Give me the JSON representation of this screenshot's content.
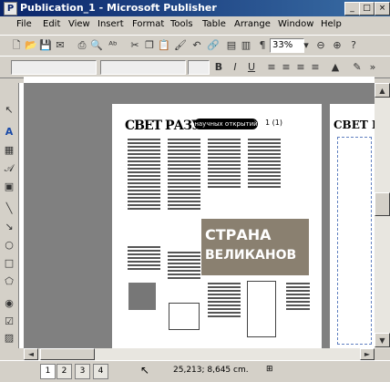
{
  "window": {
    "title": "Publication_1 - Microsoft Publisher",
    "app_icon": "P"
  },
  "menu": [
    "File",
    "Edit",
    "View",
    "Insert",
    "Format",
    "Tools",
    "Table",
    "Arrange",
    "Window",
    "Help"
  ],
  "toolbar": {
    "zoom": "33%"
  },
  "newspaper": {
    "masthead": "СВЕТ РАЗУМА",
    "banner": "научных открытий",
    "page_number": "1 (1)",
    "headline_line1": "СТРАНА",
    "headline_line2": "ВЕЛИКАНОВ",
    "right_masthead": "СВЕТ РАЗ"
  },
  "status": {
    "pages": [
      "1",
      "2",
      "3",
      "4"
    ],
    "coords": "25,213; 8,645 cm."
  },
  "colors": {
    "titlebar_start": "#0a246a",
    "titlebar_end": "#3a6ea5",
    "chrome": "#d4d0c8"
  }
}
